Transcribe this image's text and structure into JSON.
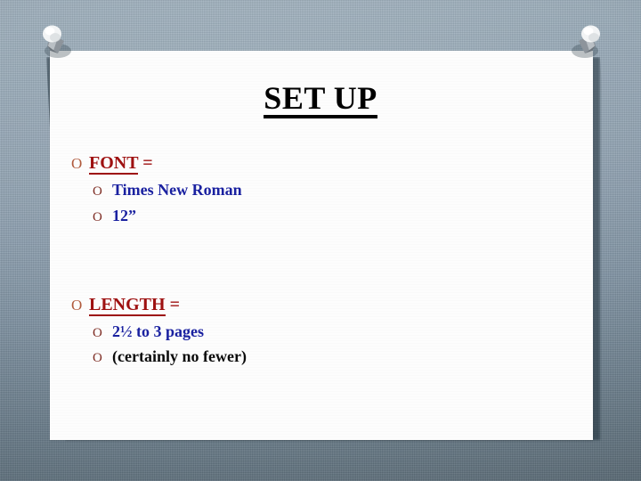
{
  "slide": {
    "title": "SET UP",
    "title_underlined": true,
    "blocks": [
      {
        "heading": "FONT",
        "heading_suffix": " =",
        "heading_color": "#9e1111",
        "bullet_marker": "O",
        "items": [
          {
            "text": "Times New Roman",
            "marker": "O",
            "color": "#1a21a0"
          },
          {
            "text": "12”",
            "marker": "O",
            "color": "#1a21a0"
          }
        ]
      },
      {
        "heading": "LENGTH",
        "heading_suffix": " =",
        "heading_color": "#9e1111",
        "bullet_marker": "O",
        "items": [
          {
            "text": "2½ to 3 pages",
            "marker": "O",
            "color": "#1a21a0"
          },
          {
            "text": "(certainly no fewer)",
            "marker": "O",
            "color": "#0b0b0b"
          }
        ]
      }
    ]
  },
  "decor": {
    "pin_left_name": "push-pin",
    "pin_right_name": "push-pin",
    "background": "#8497a8",
    "paper": "#fdfdfd",
    "title_color": "#000000",
    "accent_red": "#9e1111",
    "accent_blue": "#1a21a0",
    "marker_brown": "#7d2b22"
  }
}
